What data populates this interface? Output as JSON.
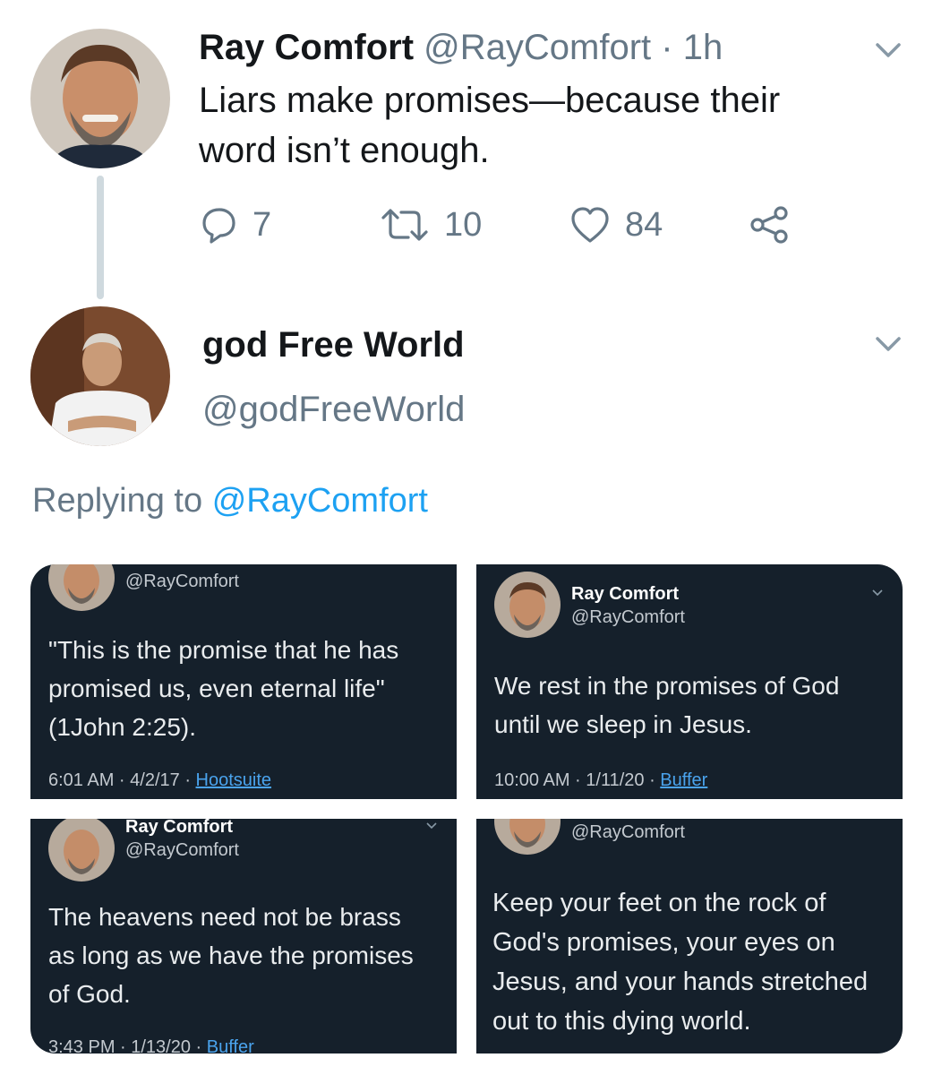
{
  "tweet": {
    "author_name": "Ray Comfort",
    "author_handle": "@RayComfort",
    "time": "· 1h",
    "text": "Liars make promises—because their word isn’t enough.",
    "replies": "7",
    "retweets": "10",
    "likes": "84"
  },
  "reply": {
    "author_name": "god Free World",
    "author_handle": "@godFreeWorld",
    "replying_prefix": "Replying to",
    "replying_to": "@RayComfort"
  },
  "images": [
    {
      "name": "",
      "handle": "@RayComfort",
      "text": "\"This is the promise that he has promised us, even eternal life\" (1John 2:25).",
      "time": "6:01 AM · 4/2/17 · ",
      "source": "Hootsuite"
    },
    {
      "name": "Ray Comfort",
      "handle": "@RayComfort",
      "text": "We rest in the promises of God until we sleep in Jesus.",
      "time": "10:00 AM · 1/11/20 · ",
      "source": "Buffer"
    },
    {
      "name": "Ray Comfort",
      "handle": "@RayComfort",
      "text": "The heavens need not be brass as long as we have the promises of God.",
      "time": "3:43 PM · 1/13/20 · ",
      "source": "Buffer"
    },
    {
      "name": "",
      "handle": "@RayComfort",
      "text": "Keep your feet on the rock of God's promises, your eyes on Jesus, and your hands stretched out to this dying world.",
      "time": "",
      "source": ""
    }
  ],
  "icons": {
    "reply": "reply-icon",
    "retweet": "retweet-icon",
    "like": "heart-icon",
    "share": "share-icon",
    "menu": "chevron-down-icon"
  },
  "colors": {
    "accent": "#1da1f2",
    "secondary_text": "#657786",
    "card_background": "#15202b"
  }
}
